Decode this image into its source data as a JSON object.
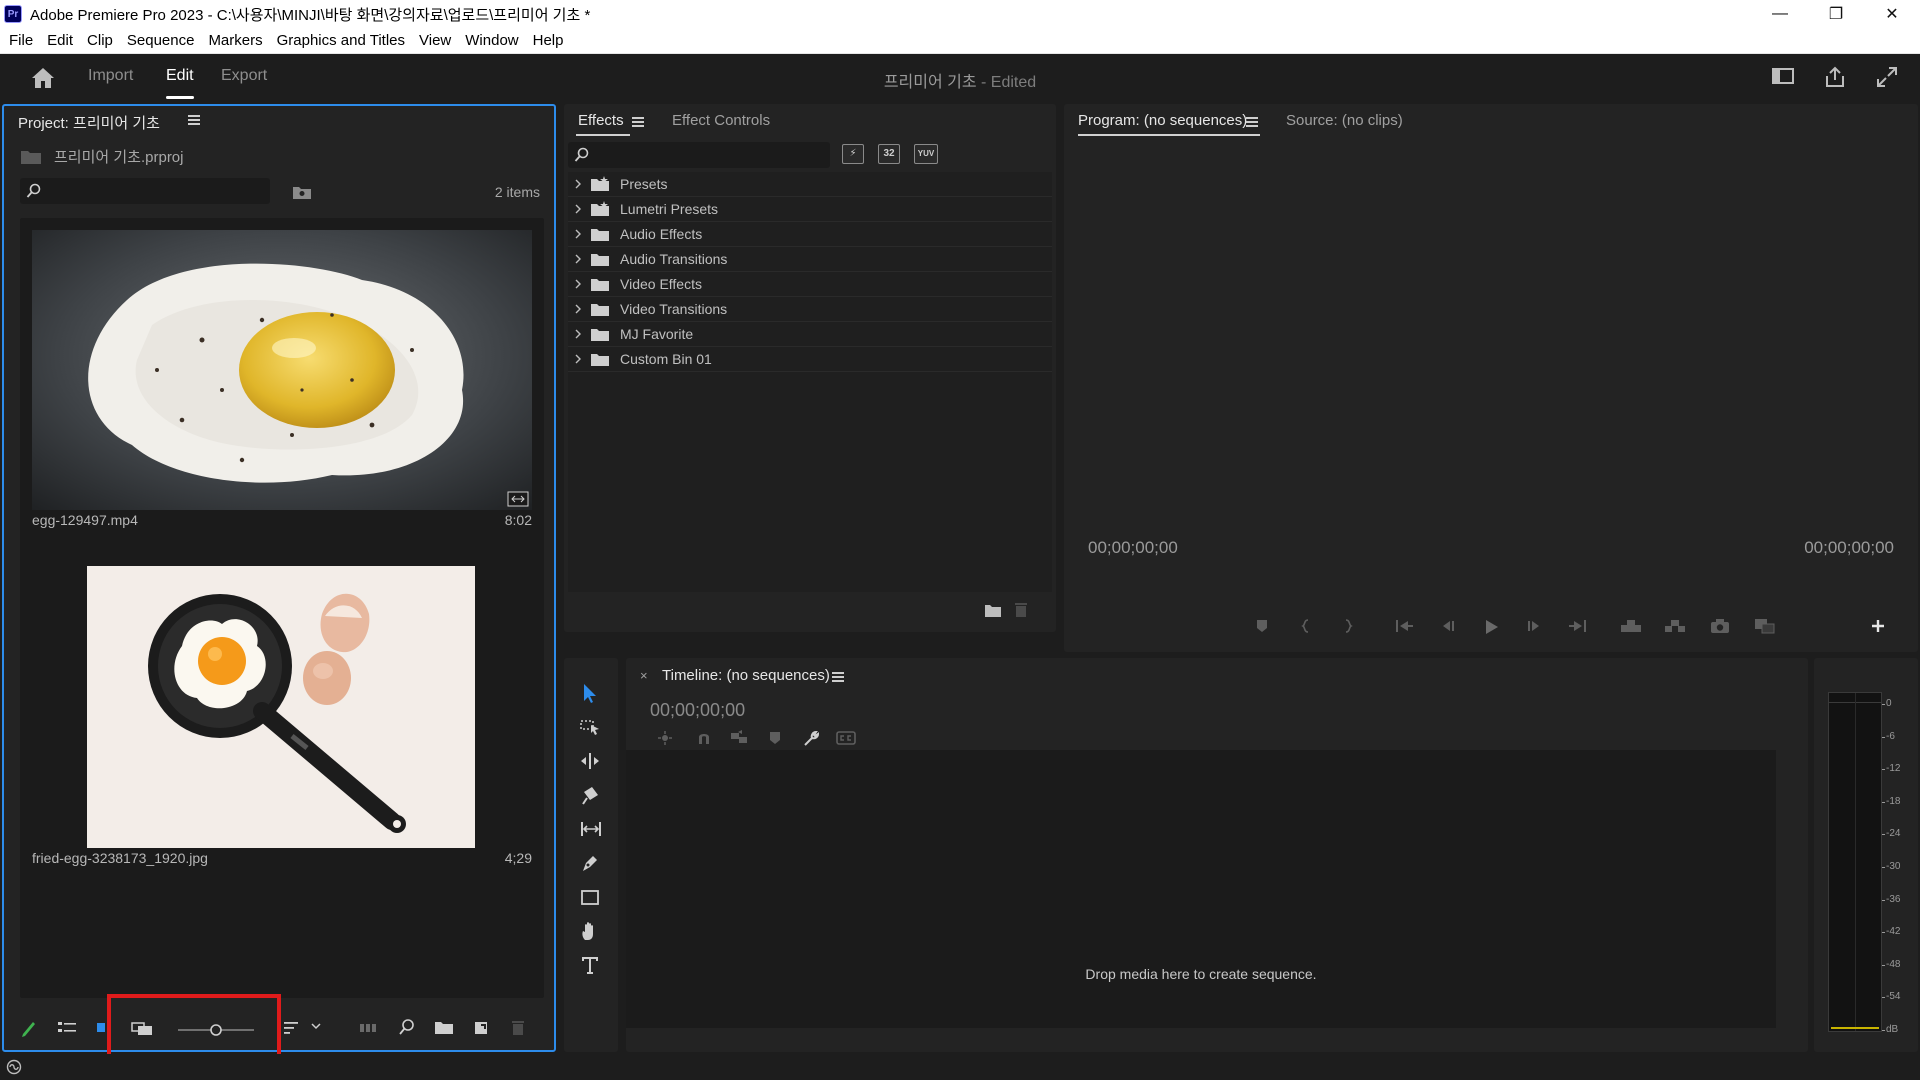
{
  "window": {
    "app_icon_text": "Pr",
    "title": "Adobe Premiere Pro 2023 - C:\\사용자\\MINJI\\바탕 화면\\강의자료\\업로드\\프리미어 기초 *",
    "minimize": "—",
    "restore": "❐",
    "close": "✕"
  },
  "menu": [
    "File",
    "Edit",
    "Clip",
    "Sequence",
    "Markers",
    "Graphics and Titles",
    "View",
    "Window",
    "Help"
  ],
  "header": {
    "tabs": [
      "Import",
      "Edit",
      "Export"
    ],
    "active_tab": "Edit",
    "doc_title": "프리미어 기초",
    "doc_status": " - Edited"
  },
  "project": {
    "title": "Project: 프리미어 기초",
    "file_name": "프리미어 기초.prproj",
    "items_count": "2 items",
    "clips": [
      {
        "name": "egg-129497.mp4",
        "duration": "8:02"
      },
      {
        "name": "fried-egg-3238173_1920.jpg",
        "duration": "4;29"
      }
    ],
    "zoom_level": 0.5
  },
  "effects": {
    "tabs": [
      "Effects",
      "Effect Controls"
    ],
    "buttons": [
      "32",
      "YUV"
    ],
    "items": [
      "Presets",
      "Lumetri Presets",
      "Audio Effects",
      "Audio Transitions",
      "Video Effects",
      "Video Transitions",
      "MJ Favorite",
      "Custom Bin 01"
    ]
  },
  "program": {
    "tab_active": "Program: (no sequences)",
    "tab_inactive": "Source: (no clips)",
    "timecode_left": "00;00;00;00",
    "timecode_right": "00;00;00;00"
  },
  "timeline": {
    "close": "×",
    "title": "Timeline: (no sequences)",
    "timecode": "00;00;00;00",
    "drop_message": "Drop media here to create sequence."
  },
  "meter": {
    "ticks": [
      "0",
      "-6",
      "-12",
      "-18",
      "-24",
      "-30",
      "-36",
      "-42",
      "-48",
      "-54",
      "dB"
    ]
  },
  "colors": {
    "accent": "#2d8ceb",
    "highlight": "#e01b1b",
    "panel": "#232323",
    "background": "#1d1d1d"
  }
}
